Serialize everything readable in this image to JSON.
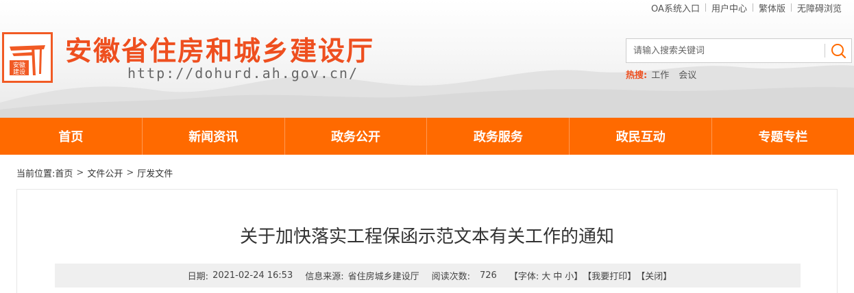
{
  "top_links": [
    "OA系统入口",
    "用户中心",
    "繁体版",
    "无障碍浏览"
  ],
  "site": {
    "title": "安徽省住房和城乡建设厅",
    "url": "http://dohurd.ah.gov.cn/",
    "logo_text": [
      "安徽",
      "建设"
    ]
  },
  "search": {
    "placeholder": "请输入搜索关键词",
    "hot_label": "热搜:",
    "hot_keywords": [
      "工作",
      "会议"
    ]
  },
  "nav": [
    "首页",
    "新闻资讯",
    "政务公开",
    "政务服务",
    "政民互动",
    "专题专栏"
  ],
  "breadcrumb": {
    "label": "当前位置:",
    "items": [
      "首页",
      "文件公开",
      "厅发文件"
    ],
    "separator": ">"
  },
  "article": {
    "title": "关于加快落实工程保函示范文本有关工作的通知",
    "date_label": "日期:",
    "date": "2021-02-24 16:53",
    "source_label": "信息来源:",
    "source": "省住房城乡建设厅",
    "views_label": "阅读次数:",
    "views": "726",
    "font_label": "【字体:",
    "font_large": "大",
    "font_medium": "中",
    "font_small": "小】",
    "print": "【我要打印】",
    "close": "【关闭】"
  },
  "colors": {
    "brand_orange": "#ff6a00",
    "title_red": "#ee4f1f"
  }
}
